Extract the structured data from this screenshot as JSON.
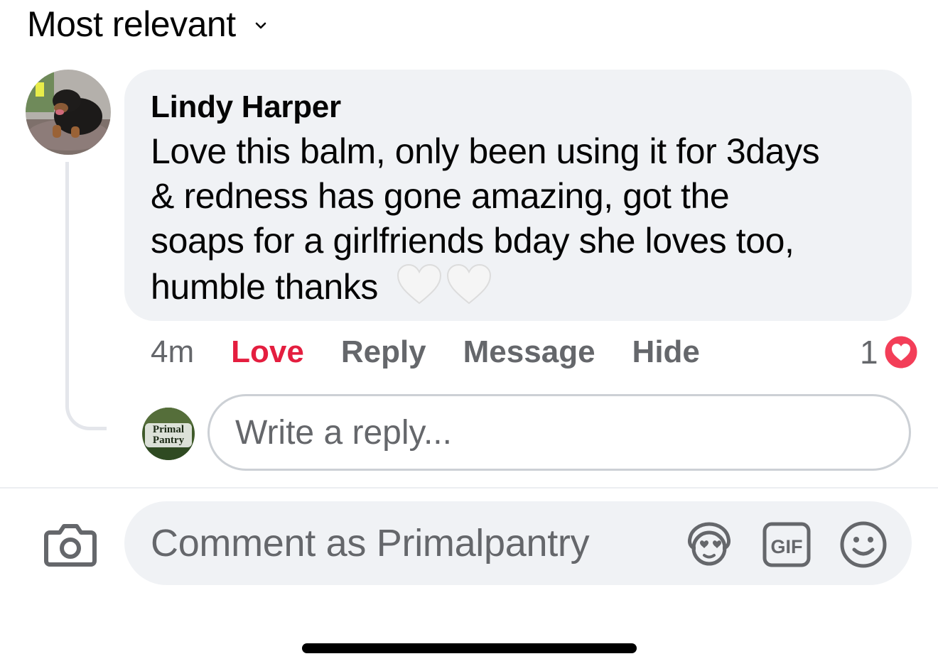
{
  "sort": {
    "label": "Most relevant",
    "icon": "chevron-down-icon"
  },
  "comment": {
    "author": "Lindy Harper",
    "text": "Love this balm, only been using it for 3days\n& redness has gone amazing, got the\nsoaps for a girlfriends bday she loves too,\nhumble thanks",
    "emoji": "white-heart-icon",
    "time": "4m",
    "actions": {
      "love": "Love",
      "reply": "Reply",
      "message": "Message",
      "hide": "Hide"
    },
    "reaction_count": "1",
    "reaction_icon": "love-reaction-icon"
  },
  "reply": {
    "avatar_text": [
      "Primal",
      "Pantry"
    ],
    "placeholder": "Write a reply..."
  },
  "composer": {
    "placeholder": "Comment as Primalpantry",
    "icons": [
      "camera-icon",
      "avatar-sticker-icon",
      "gif-icon",
      "emoji-icon"
    ]
  },
  "colors": {
    "love": "#e41e3f",
    "secondary_text": "#65676b",
    "bubble_bg": "#f0f2f5",
    "border": "#ccd0d5"
  }
}
